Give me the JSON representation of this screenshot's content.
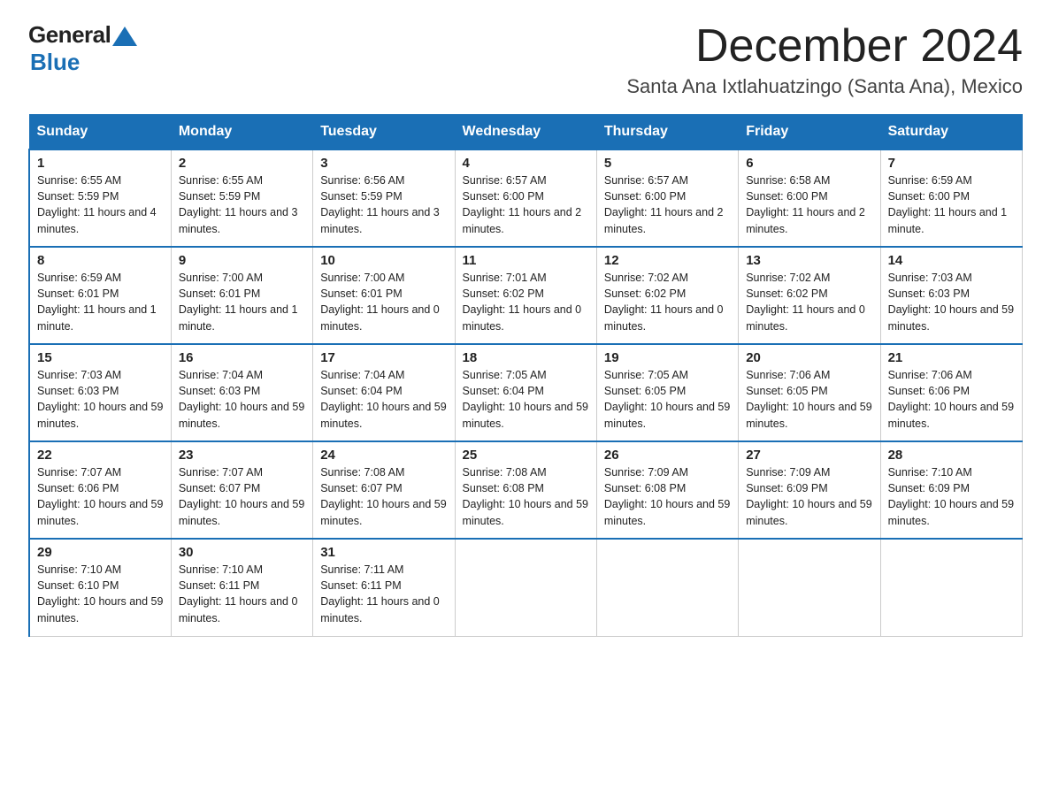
{
  "logo": {
    "general": "General",
    "blue": "Blue"
  },
  "header": {
    "month": "December 2024",
    "location": "Santa Ana Ixtlahuatzingo (Santa Ana), Mexico"
  },
  "weekdays": [
    "Sunday",
    "Monday",
    "Tuesday",
    "Wednesday",
    "Thursday",
    "Friday",
    "Saturday"
  ],
  "weeks": [
    [
      {
        "day": "1",
        "sunrise": "6:55 AM",
        "sunset": "5:59 PM",
        "daylight": "11 hours and 4 minutes."
      },
      {
        "day": "2",
        "sunrise": "6:55 AM",
        "sunset": "5:59 PM",
        "daylight": "11 hours and 3 minutes."
      },
      {
        "day": "3",
        "sunrise": "6:56 AM",
        "sunset": "5:59 PM",
        "daylight": "11 hours and 3 minutes."
      },
      {
        "day": "4",
        "sunrise": "6:57 AM",
        "sunset": "6:00 PM",
        "daylight": "11 hours and 2 minutes."
      },
      {
        "day": "5",
        "sunrise": "6:57 AM",
        "sunset": "6:00 PM",
        "daylight": "11 hours and 2 minutes."
      },
      {
        "day": "6",
        "sunrise": "6:58 AM",
        "sunset": "6:00 PM",
        "daylight": "11 hours and 2 minutes."
      },
      {
        "day": "7",
        "sunrise": "6:59 AM",
        "sunset": "6:00 PM",
        "daylight": "11 hours and 1 minute."
      }
    ],
    [
      {
        "day": "8",
        "sunrise": "6:59 AM",
        "sunset": "6:01 PM",
        "daylight": "11 hours and 1 minute."
      },
      {
        "day": "9",
        "sunrise": "7:00 AM",
        "sunset": "6:01 PM",
        "daylight": "11 hours and 1 minute."
      },
      {
        "day": "10",
        "sunrise": "7:00 AM",
        "sunset": "6:01 PM",
        "daylight": "11 hours and 0 minutes."
      },
      {
        "day": "11",
        "sunrise": "7:01 AM",
        "sunset": "6:02 PM",
        "daylight": "11 hours and 0 minutes."
      },
      {
        "day": "12",
        "sunrise": "7:02 AM",
        "sunset": "6:02 PM",
        "daylight": "11 hours and 0 minutes."
      },
      {
        "day": "13",
        "sunrise": "7:02 AM",
        "sunset": "6:02 PM",
        "daylight": "11 hours and 0 minutes."
      },
      {
        "day": "14",
        "sunrise": "7:03 AM",
        "sunset": "6:03 PM",
        "daylight": "10 hours and 59 minutes."
      }
    ],
    [
      {
        "day": "15",
        "sunrise": "7:03 AM",
        "sunset": "6:03 PM",
        "daylight": "10 hours and 59 minutes."
      },
      {
        "day": "16",
        "sunrise": "7:04 AM",
        "sunset": "6:03 PM",
        "daylight": "10 hours and 59 minutes."
      },
      {
        "day": "17",
        "sunrise": "7:04 AM",
        "sunset": "6:04 PM",
        "daylight": "10 hours and 59 minutes."
      },
      {
        "day": "18",
        "sunrise": "7:05 AM",
        "sunset": "6:04 PM",
        "daylight": "10 hours and 59 minutes."
      },
      {
        "day": "19",
        "sunrise": "7:05 AM",
        "sunset": "6:05 PM",
        "daylight": "10 hours and 59 minutes."
      },
      {
        "day": "20",
        "sunrise": "7:06 AM",
        "sunset": "6:05 PM",
        "daylight": "10 hours and 59 minutes."
      },
      {
        "day": "21",
        "sunrise": "7:06 AM",
        "sunset": "6:06 PM",
        "daylight": "10 hours and 59 minutes."
      }
    ],
    [
      {
        "day": "22",
        "sunrise": "7:07 AM",
        "sunset": "6:06 PM",
        "daylight": "10 hours and 59 minutes."
      },
      {
        "day": "23",
        "sunrise": "7:07 AM",
        "sunset": "6:07 PM",
        "daylight": "10 hours and 59 minutes."
      },
      {
        "day": "24",
        "sunrise": "7:08 AM",
        "sunset": "6:07 PM",
        "daylight": "10 hours and 59 minutes."
      },
      {
        "day": "25",
        "sunrise": "7:08 AM",
        "sunset": "6:08 PM",
        "daylight": "10 hours and 59 minutes."
      },
      {
        "day": "26",
        "sunrise": "7:09 AM",
        "sunset": "6:08 PM",
        "daylight": "10 hours and 59 minutes."
      },
      {
        "day": "27",
        "sunrise": "7:09 AM",
        "sunset": "6:09 PM",
        "daylight": "10 hours and 59 minutes."
      },
      {
        "day": "28",
        "sunrise": "7:10 AM",
        "sunset": "6:09 PM",
        "daylight": "10 hours and 59 minutes."
      }
    ],
    [
      {
        "day": "29",
        "sunrise": "7:10 AM",
        "sunset": "6:10 PM",
        "daylight": "10 hours and 59 minutes."
      },
      {
        "day": "30",
        "sunrise": "7:10 AM",
        "sunset": "6:11 PM",
        "daylight": "11 hours and 0 minutes."
      },
      {
        "day": "31",
        "sunrise": "7:11 AM",
        "sunset": "6:11 PM",
        "daylight": "11 hours and 0 minutes."
      },
      null,
      null,
      null,
      null
    ]
  ]
}
